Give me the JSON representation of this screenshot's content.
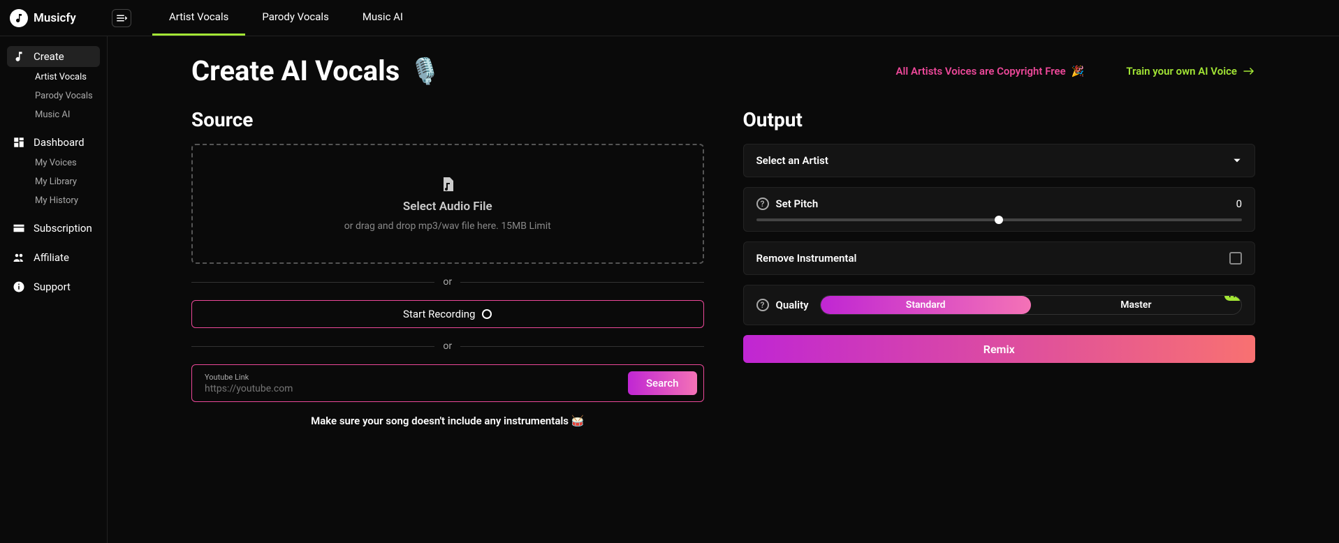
{
  "brand": "Musicfy",
  "topTabs": {
    "artist": "Artist Vocals",
    "parody": "Parody Vocals",
    "music": "Music AI"
  },
  "sidebar": {
    "create": "Create",
    "createSubs": {
      "artist": "Artist Vocals",
      "parody": "Parody Vocals",
      "music": "Music AI"
    },
    "dashboard": "Dashboard",
    "dashSubs": {
      "voices": "My Voices",
      "library": "My Library",
      "history": "My History"
    },
    "subscription": "Subscription",
    "affiliate": "Affiliate",
    "support": "Support"
  },
  "header": {
    "title": "Create AI Vocals",
    "micEmoji": "🎙️",
    "copyright": "All Artists Voices are Copyright Free",
    "copyrightEmoji": "🎉",
    "train": "Train your own AI Voice"
  },
  "source": {
    "title": "Source",
    "dropTitle": "Select Audio File",
    "dropSub": "or drag and drop mp3/wav file here. 15MB Limit",
    "or": "or",
    "record": "Start Recording",
    "ytLabel": "Youtube Link",
    "ytPlaceholder": "https://youtube.com",
    "search": "Search",
    "note": "Make sure your song doesn't include any instrumentals 🥁"
  },
  "output": {
    "title": "Output",
    "selectArtist": "Select an Artist",
    "setPitch": "Set Pitch",
    "pitchValue": "0",
    "removeInstr": "Remove Instrumental",
    "quality": "Quality",
    "qualityStandard": "Standard",
    "qualityMaster": "Master",
    "proBadge": "Pro",
    "remix": "Remix"
  }
}
